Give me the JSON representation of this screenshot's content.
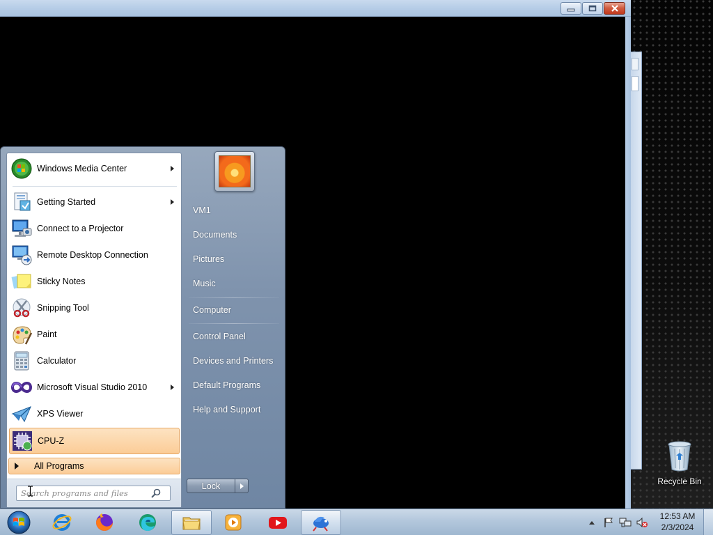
{
  "start_menu": {
    "programs": [
      {
        "label": "Windows Media Center",
        "icon": "windows-media-center-icon",
        "has_submenu": true
      },
      {
        "label": "Getting Started",
        "icon": "getting-started-icon",
        "has_submenu": true
      },
      {
        "label": "Connect to a Projector",
        "icon": "projector-icon",
        "has_submenu": false
      },
      {
        "label": "Remote Desktop Connection",
        "icon": "remote-desktop-icon",
        "has_submenu": false
      },
      {
        "label": "Sticky Notes",
        "icon": "sticky-notes-icon",
        "has_submenu": false
      },
      {
        "label": "Snipping Tool",
        "icon": "snipping-tool-icon",
        "has_submenu": false
      },
      {
        "label": "Paint",
        "icon": "paint-icon",
        "has_submenu": false
      },
      {
        "label": "Calculator",
        "icon": "calculator-icon",
        "has_submenu": false
      },
      {
        "label": "Microsoft Visual Studio 2010",
        "icon": "visual-studio-icon",
        "has_submenu": true
      },
      {
        "label": "XPS Viewer",
        "icon": "xps-viewer-icon",
        "has_submenu": false
      },
      {
        "label": "CPU-Z",
        "icon": "cpu-z-icon",
        "has_submenu": false,
        "highlighted": true
      }
    ],
    "all_programs_label": "All Programs",
    "search": {
      "placeholder": "Search programs and files",
      "value": ""
    },
    "right_items": [
      {
        "label": "VM1"
      },
      {
        "label": "Documents"
      },
      {
        "label": "Pictures"
      },
      {
        "label": "Music"
      },
      {
        "label": "Computer"
      },
      {
        "label": "Control Panel"
      },
      {
        "label": "Devices and Printers"
      },
      {
        "label": "Default Programs"
      },
      {
        "label": "Help and Support"
      }
    ],
    "lock_label": "Lock"
  },
  "desktop": {
    "recycle_bin_label": "Recycle Bin"
  },
  "taskbar": {
    "pinned": [
      {
        "name": "internet-explorer",
        "icon": "internet-explorer-icon"
      },
      {
        "name": "firefox",
        "icon": "firefox-icon"
      },
      {
        "name": "edge",
        "icon": "edge-icon"
      },
      {
        "name": "windows-explorer",
        "icon": "folder-icon",
        "active": true
      },
      {
        "name": "media-player",
        "icon": "media-player-icon"
      },
      {
        "name": "youtube",
        "icon": "youtube-icon"
      },
      {
        "name": "app",
        "icon": "bird-app-icon",
        "active": true
      }
    ],
    "clock": {
      "time": "12:53 AM",
      "date": "2/3/2024"
    }
  },
  "colors": {
    "menu_highlight": "#fbcc97",
    "taskbar": "#b3c7dc",
    "close_button": "#c2381c"
  }
}
